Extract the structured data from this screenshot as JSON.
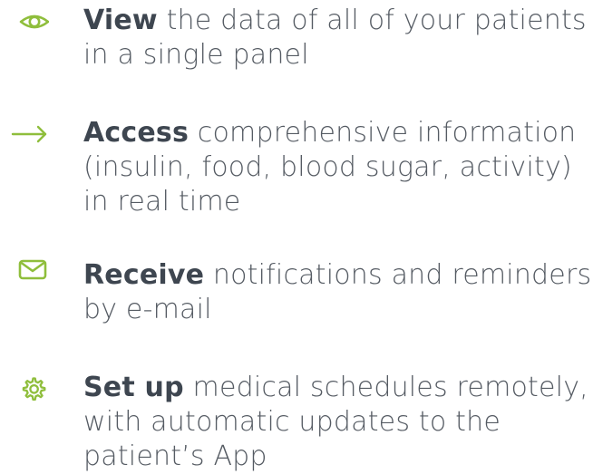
{
  "icon_color": "#8fbe3c",
  "text_color": "#555b63",
  "features": [
    {
      "icon": "eye-icon",
      "highlight": "View",
      "text": " the data of all of your patients in a single panel"
    },
    {
      "icon": "arrow-right-icon",
      "highlight": "Access",
      "text": " comprehensive information (insulin, food, blood sugar, activity) in real time"
    },
    {
      "icon": "envelope-icon",
      "highlight": "Receive",
      "text": " notifications and reminders by e-mail"
    },
    {
      "icon": "gear-icon",
      "highlight": "Set up",
      "text": " medical schedules remotely, with automatic updates to the patient’s App"
    }
  ]
}
